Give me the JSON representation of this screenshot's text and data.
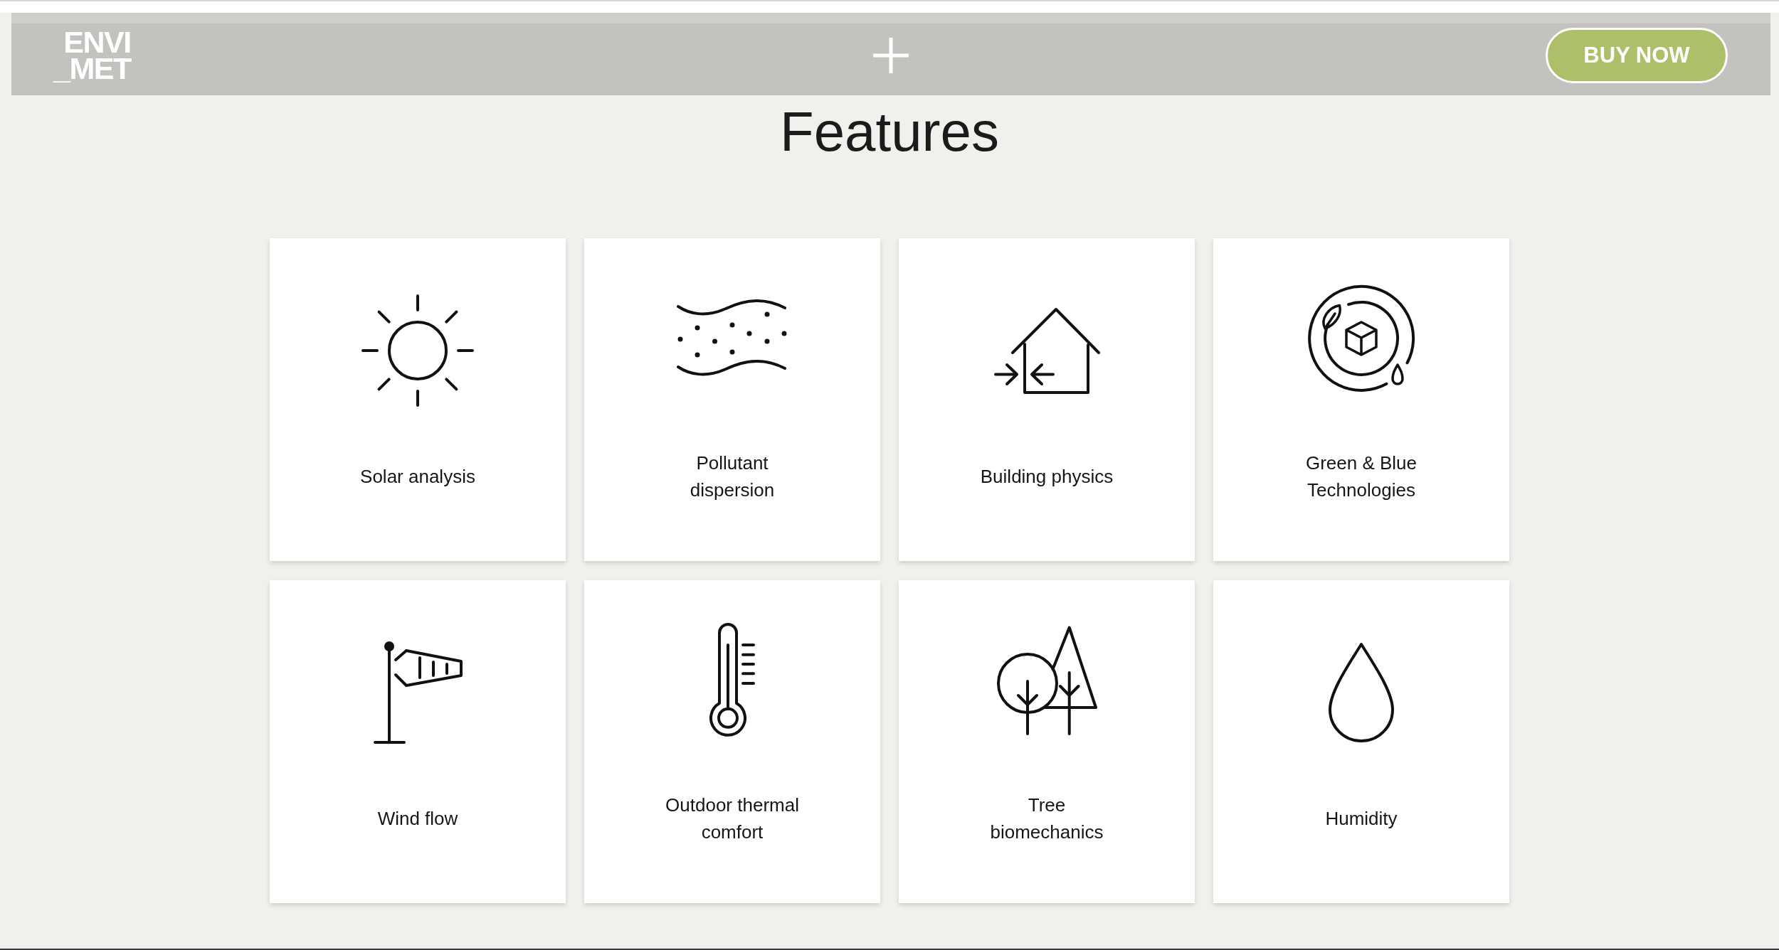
{
  "header": {
    "logo": {
      "lines": [
        "ENVI",
        "_MET"
      ]
    },
    "button": "BUY NOW"
  },
  "heading": "Features",
  "features": [
    {
      "kind": "sun",
      "label": "Solar analysis"
    },
    {
      "kind": "pollutant",
      "label": "Pollutant dispersion"
    },
    {
      "kind": "house",
      "label": "Building physics"
    },
    {
      "kind": "green-blue",
      "label": "Green & Blue Technologies"
    },
    {
      "kind": "windsock",
      "label": "Wind flow"
    },
    {
      "kind": "thermometer",
      "label": "Outdoor thermal comfort"
    },
    {
      "kind": "trees",
      "label": "Tree biomechanics"
    },
    {
      "kind": "drop",
      "label": "Humidity"
    }
  ]
}
